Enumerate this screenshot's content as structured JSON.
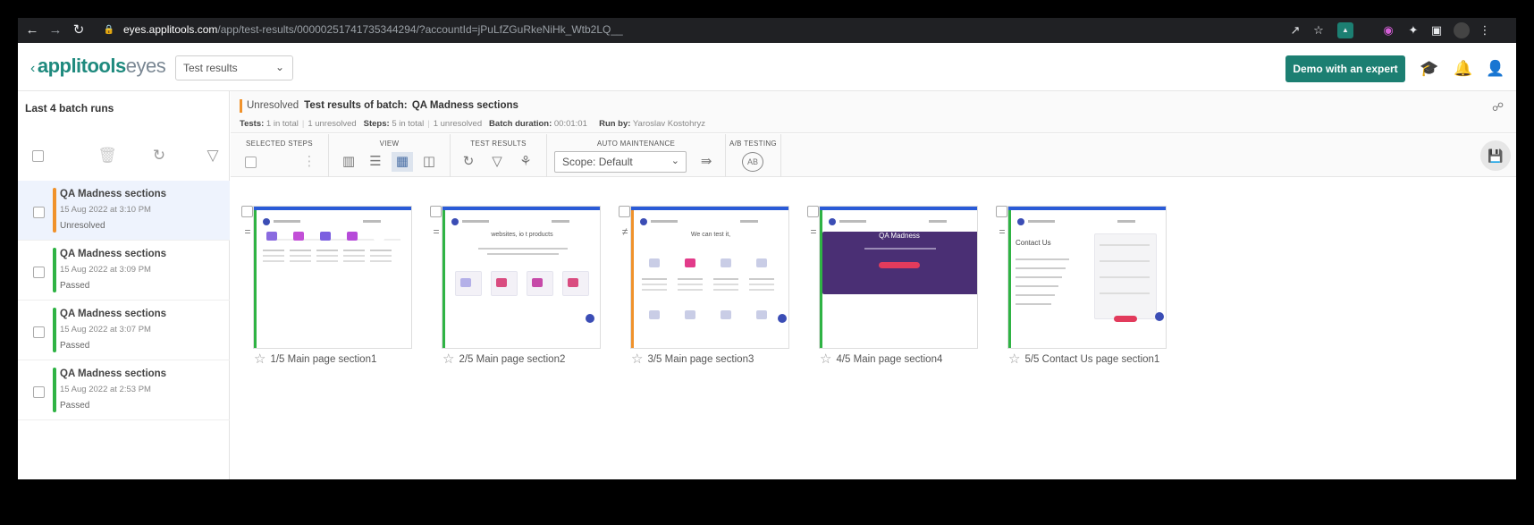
{
  "browser": {
    "url_host": "eyes.applitools.com",
    "url_rest": "/app/test-results/00000251741735344294/?accountId=jPuLfZGuRkeNiHk_Wtb2LQ__"
  },
  "header": {
    "logo_main": "applitools",
    "logo_sub": "eyes",
    "view_select": "Test results",
    "demo_button": "Demo with an expert"
  },
  "left_panel": {
    "title": "Last 4 batch runs",
    "runs": [
      {
        "name": "QA Madness sections",
        "date": "15 Aug 2022 at 3:10 PM",
        "status": "Unresolved",
        "color": "#f0922b"
      },
      {
        "name": "QA Madness sections",
        "date": "15 Aug 2022 at 3:09 PM",
        "status": "Passed",
        "color": "#2fb344"
      },
      {
        "name": "QA Madness sections",
        "date": "15 Aug 2022 at 3:07 PM",
        "status": "Passed",
        "color": "#2fb344"
      },
      {
        "name": "QA Madness sections",
        "date": "15 Aug 2022 at 2:53 PM",
        "status": "Passed",
        "color": "#2fb344"
      }
    ]
  },
  "batch": {
    "status": "Unresolved",
    "title": "Test results of batch:",
    "name": "QA Madness sections",
    "tests_label": "Tests:",
    "tests_total": "1 in total",
    "tests_unresolved": "1 unresolved",
    "steps_label": "Steps:",
    "steps_total": "5 in total",
    "steps_unresolved": "1 unresolved",
    "duration_label": "Batch duration:",
    "duration": "00:01:01",
    "run_by_label": "Run by:",
    "run_by": "Yaroslav Kostohryz"
  },
  "toolbar": {
    "selected_steps": "SELECTED STEPS",
    "view": "VIEW",
    "test_results": "TEST RESULTS",
    "auto_maintenance": "AUTO MAINTENANCE",
    "ab_testing": "A/B TESTING",
    "scope": "Scope: Default"
  },
  "steps": [
    {
      "caption": "1/5 Main page section1",
      "status_color": "#2fb344",
      "side_icon": "="
    },
    {
      "caption": "2/5 Main page section2",
      "status_color": "#2fb344",
      "side_icon": "="
    },
    {
      "caption": "3/5 Main page section3",
      "status_color": "#f0922b",
      "side_icon": "≠"
    },
    {
      "caption": "4/5 Main page section4",
      "status_color": "#2fb344",
      "side_icon": "="
    },
    {
      "caption": "5/5 Contact Us page section1",
      "status_color": "#2fb344",
      "side_icon": "="
    }
  ],
  "shot_text": {
    "s2_heading": "websites, io t products",
    "s3_heading": "We can test it,",
    "s4_heading": "QA Madness",
    "s5_heading": "Contact Us"
  }
}
